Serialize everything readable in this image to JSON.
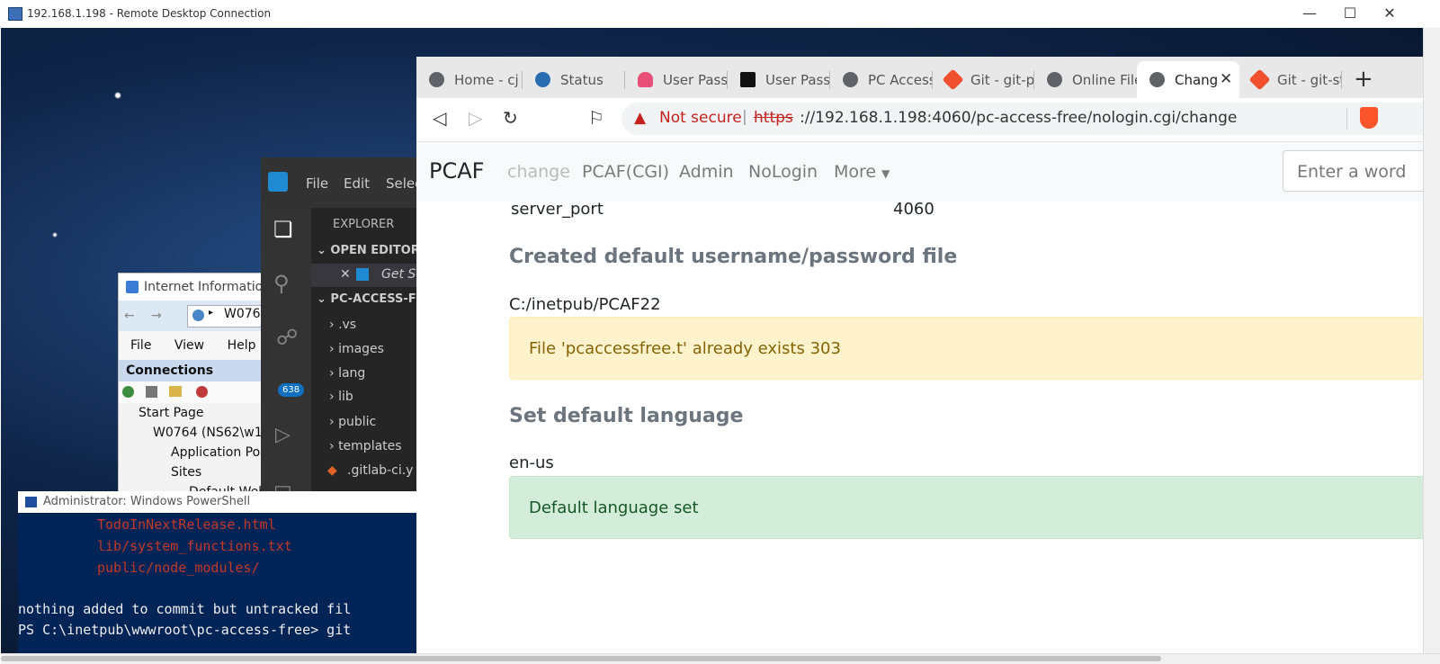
{
  "rdp": {
    "title": "192.168.1.198 - Remote Desktop Connection",
    "minimize_icon": "minimize-icon",
    "maximize_icon": "maximize-icon",
    "close_icon": "close-icon"
  },
  "iis": {
    "title": "Internet Information",
    "address": "W076",
    "menu": [
      "File",
      "View",
      "Help"
    ],
    "connections_label": "Connections",
    "tree": [
      "Start Page",
      "W0764 (NS62\\w1",
      "Application Po",
      "Sites",
      "Default Web"
    ]
  },
  "vscode": {
    "menu": [
      "File",
      "Edit",
      "Selec"
    ],
    "explorer_label": "EXPLORER",
    "open_editors_label": "OPEN EDITORS",
    "open_editor_file": "Get S",
    "project_label": "PC-ACCESS-FR",
    "folders": [
      ".vs",
      "images",
      "lang",
      "lib",
      "public",
      "templates"
    ],
    "file": ".gitlab-ci.y",
    "scm_badge": "638"
  },
  "powershell": {
    "title": "Administrator: Windows PowerShell",
    "lines": [
      "TodoInNextRelease.html",
      "lib/system_functions.txt",
      "public/node_modules/",
      "nothing added to commit but untracked fil",
      "PS C:\\inetpub\\wwwroot\\pc-access-free> git"
    ]
  },
  "browser": {
    "tabs": [
      {
        "label": "Home - cj",
        "icon": "globe-icon"
      },
      {
        "label": "Status",
        "icon": "status-icon"
      },
      {
        "label": "User Pass f",
        "icon": "cloud-icon"
      },
      {
        "label": "User Pass f",
        "icon": "up-icon"
      },
      {
        "label": "PC Access",
        "icon": "globe-icon"
      },
      {
        "label": "Git - git-p",
        "icon": "git-icon"
      },
      {
        "label": "Online File",
        "icon": "globe-icon"
      },
      {
        "label": "Chang",
        "icon": "globe-icon"
      },
      {
        "label": "Git - git-st",
        "icon": "git-icon"
      }
    ],
    "new_tab_label": "+",
    "security_label": "Not secure",
    "url_scheme": "https",
    "url_rest": "://192.168.1.198:4060/pc-access-free/nologin.cgi/change"
  },
  "site": {
    "brand": "PCAF",
    "nav": [
      "change",
      "PCAF(CGI)",
      "Admin",
      "NoLogin",
      "More"
    ],
    "search_placeholder": "Enter a word",
    "server_port_label": "server_port",
    "server_port_value": "4060",
    "heading1": "Created default username/password file",
    "path": "C:/inetpub/PCAF22",
    "warning": "File 'pcaccessfree.t' already exists 303",
    "heading2": "Set default language",
    "language": "en-us",
    "success": "Default language set"
  },
  "colors": {
    "warning_bg": "#fff3cd",
    "success_bg": "#d4edda",
    "not_secure": "#c5221f"
  }
}
